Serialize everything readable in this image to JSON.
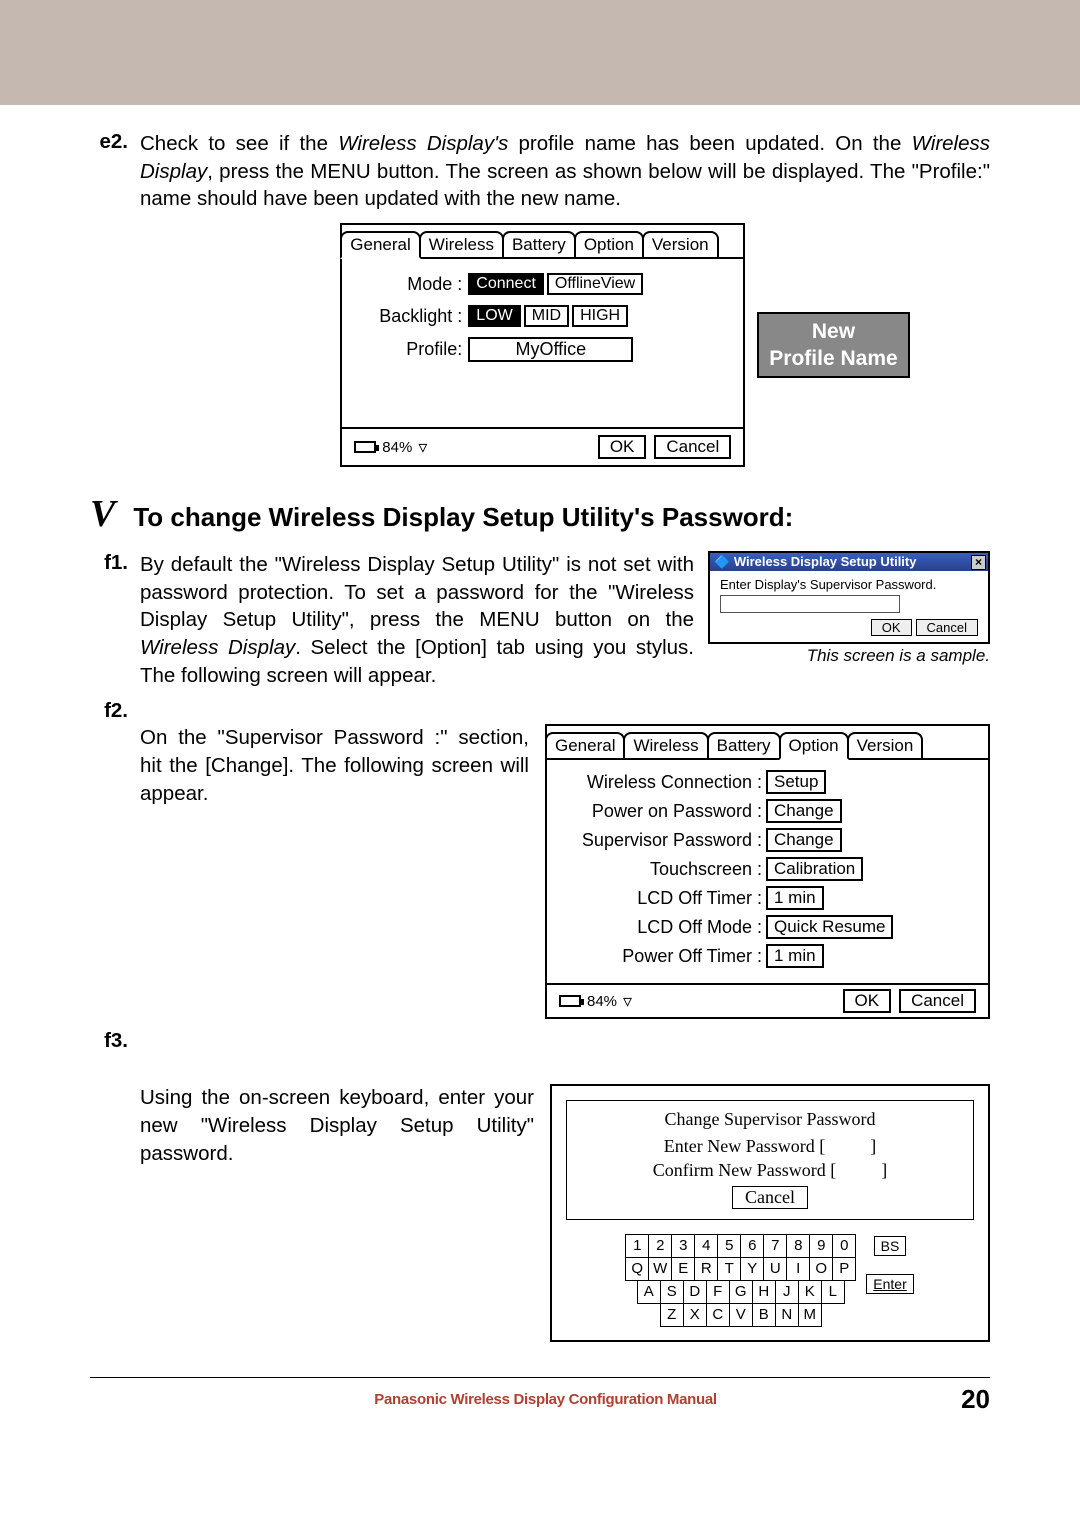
{
  "step_e2": {
    "label": "e2.",
    "text_parts": [
      "Check to see if the ",
      "Wireless Display's",
      " profile name has been updated. On the ",
      "Wireless Display",
      ", press the MENU button. The screen as shown below will be displayed. The \"Profile:\" name should have been updated with the new name."
    ]
  },
  "fig1": {
    "tabs": [
      "General",
      "Wireless",
      "Battery",
      "Option",
      "Version"
    ],
    "active_tab": 0,
    "mode_label": "Mode :",
    "mode_options": [
      "Connect",
      "OfflineView"
    ],
    "mode_selected": 0,
    "backlight_label": "Backlight :",
    "backlight_options": [
      "LOW",
      "MID",
      "HIGH"
    ],
    "backlight_selected": 0,
    "profile_label": "Profile:",
    "profile_value": "MyOffice",
    "battery_text": "84%",
    "ok": "OK",
    "cancel": "Cancel"
  },
  "callout": {
    "line1": "New",
    "line2": "Profile Name"
  },
  "section_v": {
    "letter": "V",
    "title": "To change Wireless Display Setup Utility's Password:"
  },
  "step_f1": {
    "label": "f1.",
    "text_parts": [
      "By default the \"Wireless Display Setup Utility\" is not set with password protection. To set a password for the \"Wireless Display Setup Utility\", press the MENU button on the ",
      "Wireless Display",
      ". Select the [Option] tab using you stylus. The following screen will appear."
    ]
  },
  "dialog1": {
    "title": "Wireless Display Setup Utility",
    "prompt": "Enter Display's Supervisor Password.",
    "ok": "OK",
    "cancel": "Cancel",
    "note": "This screen is a sample."
  },
  "step_f2": {
    "label": "f2.",
    "text": "On the \"Supervisor Password :\" section, hit the [Change]. The following screen will appear."
  },
  "fig2": {
    "tabs": [
      "General",
      "Wireless",
      "Battery",
      "Option",
      "Version"
    ],
    "active_tab": 3,
    "rows": [
      {
        "label": "Wireless Connection :",
        "value": "Setup"
      },
      {
        "label": "Power on Password :",
        "value": "Change"
      },
      {
        "label": "Supervisor Password :",
        "value": "Change"
      },
      {
        "label": "Touchscreen :",
        "value": "Calibration"
      },
      {
        "label": "LCD Off Timer :",
        "value": "1  min"
      },
      {
        "label": "LCD Off Mode :",
        "value": "Quick Resume"
      },
      {
        "label": "Power Off Timer :",
        "value": "1  min"
      }
    ],
    "battery_text": "84%",
    "ok": "OK",
    "cancel": "Cancel"
  },
  "step_f3": {
    "label": "f3.",
    "text": "Using the on-screen keyboard, enter your new \"Wireless Display Setup Utility\" password."
  },
  "kb": {
    "title": "Change Supervisor Password",
    "enter_label": "Enter New Password  [",
    "enter_close": "]",
    "confirm_label": "Confirm New Password  [",
    "confirm_close": "]",
    "cancel": "Cancel",
    "rows": [
      [
        "1",
        "2",
        "3",
        "4",
        "5",
        "6",
        "7",
        "8",
        "9",
        "0"
      ],
      [
        "Q",
        "W",
        "E",
        "R",
        "T",
        "Y",
        "U",
        "I",
        "O",
        "P"
      ],
      [
        "A",
        "S",
        "D",
        "F",
        "G",
        "H",
        "J",
        "K",
        "L"
      ],
      [
        "Z",
        "X",
        "C",
        "V",
        "B",
        "N",
        "M"
      ]
    ],
    "bs": "BS",
    "enter": "Enter"
  },
  "footer": {
    "text": "Panasonic Wireless Display Configuration Manual",
    "page": "20"
  }
}
